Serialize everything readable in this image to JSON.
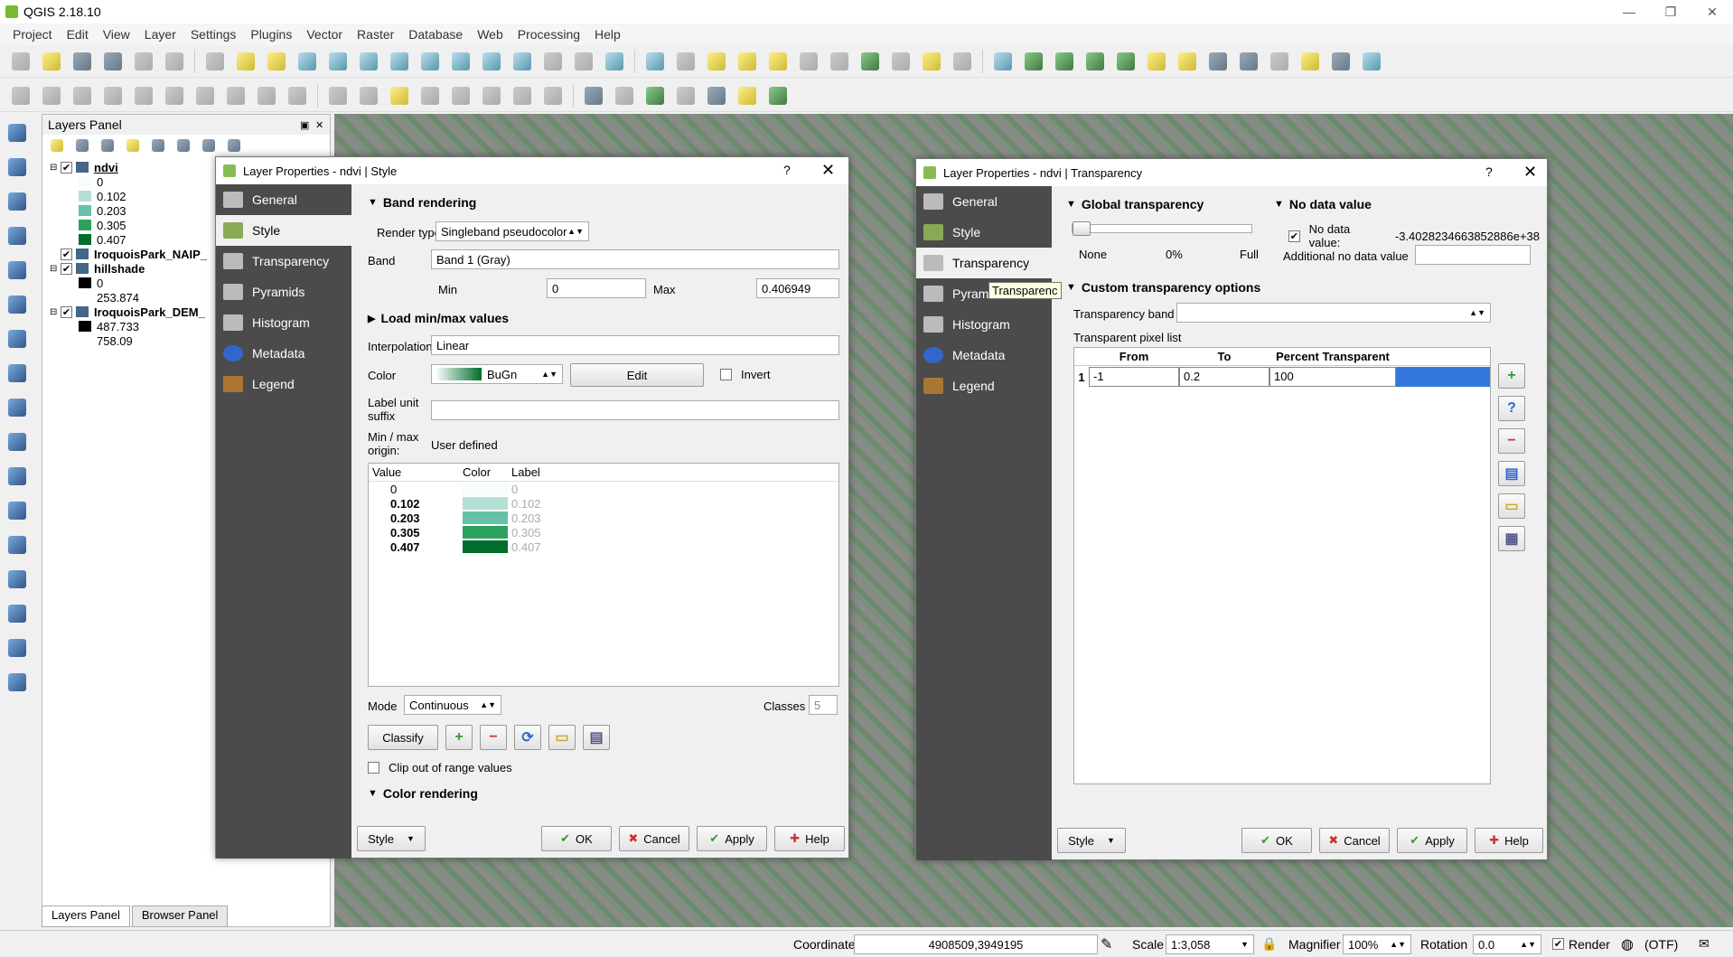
{
  "app": {
    "title": "QGIS 2.18.10"
  },
  "menu": [
    "Project",
    "Edit",
    "View",
    "Layer",
    "Settings",
    "Plugins",
    "Vector",
    "Raster",
    "Database",
    "Web",
    "Processing",
    "Help"
  ],
  "layers_panel": {
    "title": "Layers Panel",
    "layers": [
      {
        "name": "ndvi",
        "classes": [
          {
            "label": "0",
            "color": "#f7fcfd"
          },
          {
            "label": "0.102",
            "color": "#b2e0d5"
          },
          {
            "label": "0.203",
            "color": "#66c2a4"
          },
          {
            "label": "0.305",
            "color": "#2ca25f"
          },
          {
            "label": "0.407",
            "color": "#006d2c"
          }
        ]
      },
      {
        "name": "IroquoisPark_NAIP_",
        "classes": []
      },
      {
        "name": "hillshade",
        "classes": [
          {
            "label": "0",
            "color": "#000000"
          },
          {
            "label": "253.874",
            "color": "#ffffff"
          }
        ]
      },
      {
        "name": "IroquoisPark_DEM_",
        "classes": [
          {
            "label": "487.733",
            "color": "#000000"
          },
          {
            "label": "758.09",
            "color": "#ffffff"
          }
        ]
      }
    ],
    "tabs": [
      "Layers Panel",
      "Browser Panel"
    ]
  },
  "style_dialog": {
    "title": "Layer Properties - ndvi | Style",
    "help_glyph": "?",
    "close_glyph": "✕",
    "nav": [
      "General",
      "Style",
      "Transparency",
      "Pyramids",
      "Histogram",
      "Metadata",
      "Legend"
    ],
    "band_rendering": "Band rendering",
    "render_type_label": "Render type",
    "render_type": "Singleband pseudocolor",
    "band_label": "Band",
    "band": "Band 1 (Gray)",
    "min_label": "Min",
    "min": "0",
    "max_label": "Max",
    "max": "0.406949",
    "load_minmax": "Load min/max values",
    "interp_label": "Interpolation",
    "interp": "Linear",
    "color_label": "Color",
    "color_ramp": "BuGn",
    "edit": "Edit",
    "invert": "Invert",
    "unit_label_1": "Label unit",
    "unit_label_2": "suffix",
    "minmax_origin_1": "Min / max",
    "minmax_origin_2": "origin:",
    "minmax_origin_value": "User defined",
    "table_headers": [
      "Value",
      "Color",
      "Label"
    ],
    "table_rows": [
      {
        "value": "0",
        "color": "#f7fcfd",
        "label": "0"
      },
      {
        "value": "0.102",
        "color": "#b2e0d5",
        "label": "0.102"
      },
      {
        "value": "0.203",
        "color": "#66c2a4",
        "label": "0.203"
      },
      {
        "value": "0.305",
        "color": "#2ca25f",
        "label": "0.305"
      },
      {
        "value": "0.407",
        "color": "#006d2c",
        "label": "0.407"
      }
    ],
    "mode_label": "Mode",
    "mode": "Continuous",
    "classes_label": "Classes",
    "classes": "5",
    "classify": "Classify",
    "clip": "Clip out of range values",
    "color_rendering": "Color rendering",
    "style_btn": "Style",
    "ok": "OK",
    "cancel": "Cancel",
    "apply": "Apply",
    "help": "Help"
  },
  "transparency_dialog": {
    "title": "Layer Properties - ndvi | Transparency",
    "help_glyph": "?",
    "close_glyph": "✕",
    "nav": [
      "General",
      "Style",
      "Transparency",
      "Pyramids",
      "Histogram",
      "Metadata",
      "Legend"
    ],
    "tooltip": "Transparenc",
    "global": "Global transparency",
    "none": "None",
    "pct": "0%",
    "full": "Full",
    "nodata": "No data value",
    "nodata_label": "No data value:",
    "nodata_value": "-3.4028234663852886e+38",
    "additional": "Additional no data value",
    "custom": "Custom transparency options",
    "band_label": "Transparency band",
    "pixel_list": "Transparent pixel list",
    "headers": [
      "From",
      "To",
      "Percent Transparent"
    ],
    "rows": [
      {
        "n": "1",
        "from": "-1",
        "to": "0.2",
        "pct": "100"
      }
    ],
    "style_btn": "Style",
    "ok": "OK",
    "cancel": "Cancel",
    "apply": "Apply",
    "help": "Help"
  },
  "status": {
    "coord_label": "Coordinate",
    "coord": "4908509,3949195",
    "scale_label": "Scale",
    "scale": "1:3,058",
    "magnifier_label": "Magnifier",
    "magnifier": "100%",
    "rotation_label": "Rotation",
    "rotation": "0.0",
    "render": "Render",
    "crs": "(OTF)"
  }
}
